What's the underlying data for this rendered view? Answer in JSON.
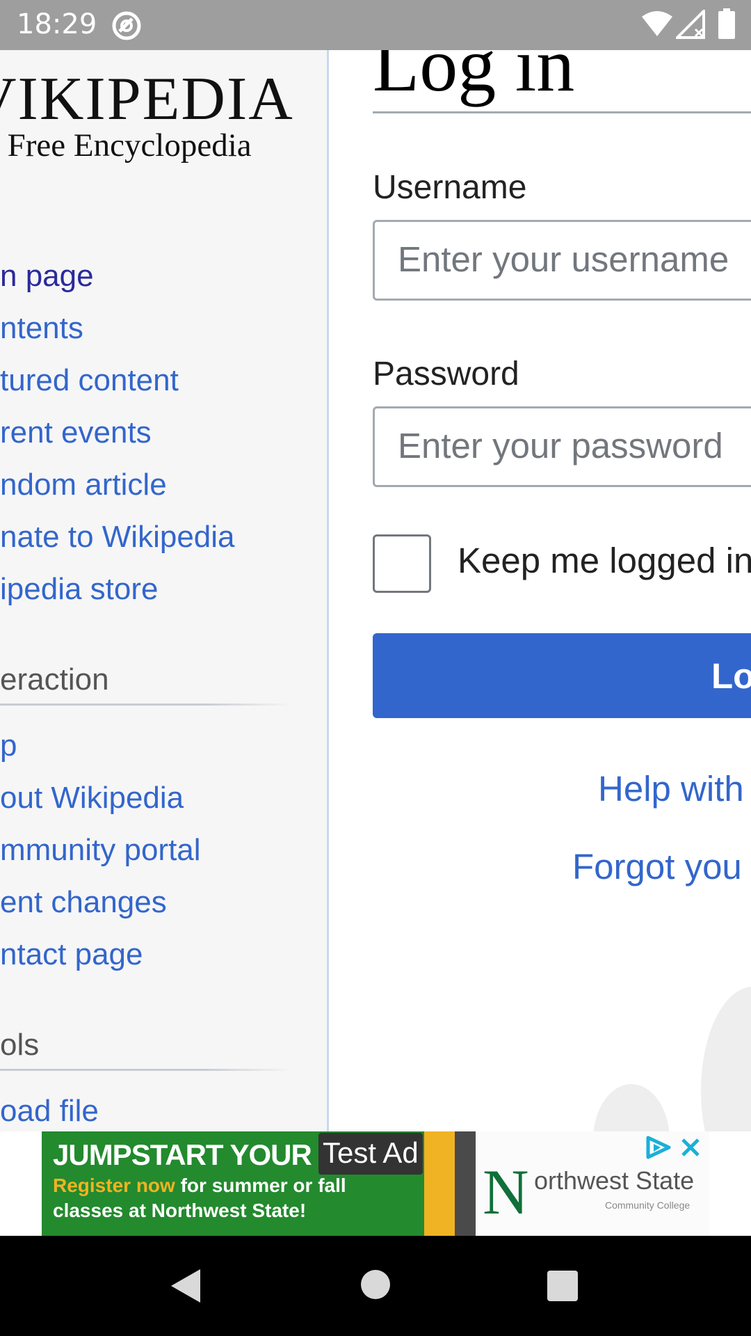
{
  "status_bar": {
    "time": "18:29",
    "icons": [
      "sync-icon",
      "wifi-icon",
      "signal-icon",
      "battery-icon"
    ]
  },
  "sidebar": {
    "logo_wordmark": "VIKIPEDIA",
    "logo_tagline": "e Free Encyclopedia",
    "nav_items": [
      {
        "label": "n page"
      },
      {
        "label": "ntents"
      },
      {
        "label": "tured content"
      },
      {
        "label": "rent events"
      },
      {
        "label": "ndom article"
      },
      {
        "label": "nate to Wikipedia"
      },
      {
        "label": "ipedia store"
      }
    ],
    "interaction_heading": "eraction",
    "interaction_items": [
      {
        "label": "p"
      },
      {
        "label": "out Wikipedia"
      },
      {
        "label": "mmunity portal"
      },
      {
        "label": "ent changes"
      },
      {
        "label": "ntact page"
      }
    ],
    "tools_heading": "ols",
    "tools_items": [
      {
        "label": "oad file"
      }
    ]
  },
  "login": {
    "title": "Log in",
    "username_label": "Username",
    "username_placeholder": "Enter your username",
    "password_label": "Password",
    "password_placeholder": "Enter your password",
    "keep_logged_in_label": "Keep me logged in",
    "keep_logged_in_checked": false,
    "login_button_label": "Lo",
    "help_link": "Help with",
    "forgot_link": "Forgot you"
  },
  "ad": {
    "headline": "JUMPSTART YOUR F",
    "line1_highlight": "Register now",
    "line1_rest": " for summer or fall",
    "line2": "classes at Northwest State!",
    "test_ad_badge": "Test Ad",
    "advertiser_logo_letter": "N",
    "advertiser_name": "orthwest State",
    "advertiser_sub": "Community College",
    "colors": {
      "green": "#238a2e",
      "yellow": "#f0b323"
    }
  },
  "colors": {
    "link": "#3366cc",
    "visited_link": "#2a2a9c",
    "primary_button": "#3366cc",
    "sidebar_bg": "#f6f6f6"
  }
}
